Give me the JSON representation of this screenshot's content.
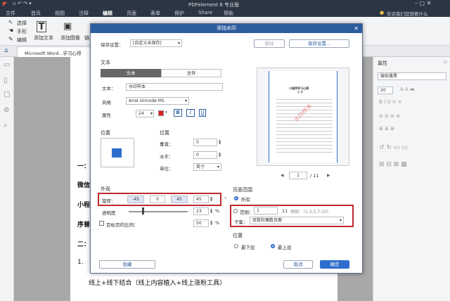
{
  "app": {
    "title": "PDFelement 6 专业版",
    "feedback": "告诉我们您想要什么"
  },
  "menu": [
    "文件",
    "首页",
    "视图",
    "注释",
    "编辑",
    "页面",
    "表单",
    "保护",
    "Share",
    "帮助"
  ],
  "ribbon": {
    "tools": [
      "选择",
      "手形",
      "编辑"
    ],
    "buttons": [
      "添加文本",
      "添加图像",
      "链接"
    ]
  },
  "doc_tab": "Microsoft Word...学习心得",
  "right_panel": {
    "title": "属性",
    "font": "微软雅黑",
    "size": "20"
  },
  "doc_text": {
    "line1": "一：",
    "line2": "微信",
    "line3": "小程",
    "line4": "序普",
    "line5": "二：",
    "line6": "1.",
    "bottom": "线上+线下结合（线上内容植入+线上涨粉工具）"
  },
  "dialog": {
    "title": "添加水印",
    "preset_label": "保存设置：",
    "preset_value": "[自定义未保存]",
    "delete_btn": "删除",
    "save_btn": "保存设置...",
    "source_label": "文本",
    "tab_text": "文本",
    "tab_file": "文件",
    "text_label": "文本：",
    "text_value": "水印样本",
    "style_label": "风格",
    "font_value": "Arial Unicode MS",
    "attr_label": "属性",
    "size_value": "24",
    "bold": "B",
    "italic": "I",
    "underline": "U",
    "position_title": "位置",
    "position_title2": "位置",
    "vertical_label": "垂直：",
    "vertical_value": "0",
    "horizontal_label": "水平：",
    "horizontal_value": "0",
    "unit_label": "单位：",
    "unit_value": "英寸",
    "appearance_title": "外观",
    "rotation_label": "旋转：",
    "rot_neg45": "-45",
    "rot_0": "0",
    "rot_45": "45",
    "rot_value": "45",
    "rot_unit": "°",
    "opacity_label": "透明度",
    "opacity_value": "23",
    "opacity_unit": "%",
    "scale_label": "目标页的比例：",
    "scale_value": "50",
    "scale_unit": "%",
    "page_current": "1",
    "page_total": "/ 11",
    "page_range_title": "页面范围",
    "all_label": "所有",
    "range_label": "范围：",
    "range_from": "1",
    "range_to": "11",
    "range_example": "例如：（1,3,5,7-10）",
    "subset_label": "子集：",
    "subset_value": "奇数和偶数页面",
    "layer_title": "位置",
    "below_label": "最下层",
    "above_label": "最上层",
    "hide_btn": "隐藏",
    "cancel_btn": "取消",
    "ok_btn": "确定",
    "preview": {
      "title": "小程序学习心得",
      "sub": "名   称",
      "watermark": "水印样本"
    }
  },
  "colors": {
    "accent": "#2d6ecc",
    "highlight": "#c0282d",
    "watermark": "#e23a3a"
  }
}
